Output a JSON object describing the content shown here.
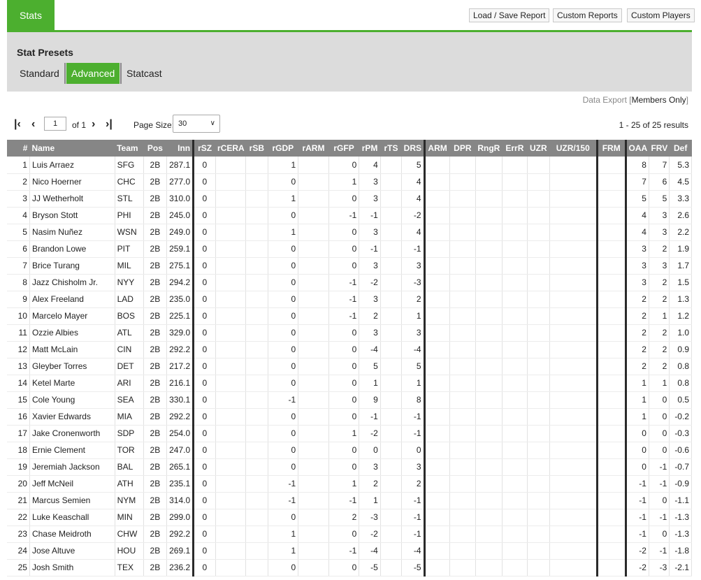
{
  "tabs": {
    "stats": "Stats"
  },
  "top_buttons": {
    "load_save": "Load / Save Report",
    "custom_reports": "Custom Reports",
    "custom_players": "Custom Players"
  },
  "presets": {
    "title": "Stat Presets",
    "items": [
      "Standard",
      "Advanced",
      "Statcast"
    ],
    "active": "Advanced"
  },
  "data_export": {
    "label": "Data Export",
    "bracket_open": "[",
    "members": "Members Only",
    "bracket_close": "]"
  },
  "pager": {
    "page": "1",
    "of": "of 1",
    "page_size_label": "Page Size:",
    "page_size": "30",
    "results": "1 - 25 of 25 results"
  },
  "colors": {
    "accent": "#4caf2f",
    "header_bg": "#868686",
    "presets_bg": "#dcdcdc"
  },
  "icons": [
    "first-page-icon",
    "prev-page-icon",
    "next-page-icon",
    "last-page-icon",
    "chevron-down-icon"
  ],
  "table": {
    "headers": [
      "#",
      "Name",
      "Team",
      "Pos",
      "Inn",
      "rSZ",
      "rCERA",
      "rSB",
      "rGDP",
      "rARM",
      "rGFP",
      "rPM",
      "rTS",
      "DRS",
      "ARM",
      "DPR",
      "RngR",
      "ErrR",
      "UZR",
      "UZR/150",
      "FRM",
      "OAA",
      "FRV",
      "Def"
    ],
    "rows": [
      [
        "1",
        "Luis Arraez",
        "SFG",
        "2B",
        "287.1",
        "0",
        "",
        "",
        "1",
        "",
        "0",
        "4",
        "",
        "5",
        "",
        "",
        "",
        "",
        "",
        "",
        "",
        "8",
        "7",
        "5.3"
      ],
      [
        "2",
        "Nico Hoerner",
        "CHC",
        "2B",
        "277.0",
        "0",
        "",
        "",
        "0",
        "",
        "1",
        "3",
        "",
        "4",
        "",
        "",
        "",
        "",
        "",
        "",
        "",
        "7",
        "6",
        "4.5"
      ],
      [
        "3",
        "JJ Wetherholt",
        "STL",
        "2B",
        "310.0",
        "0",
        "",
        "",
        "1",
        "",
        "0",
        "3",
        "",
        "4",
        "",
        "",
        "",
        "",
        "",
        "",
        "",
        "5",
        "5",
        "3.3"
      ],
      [
        "4",
        "Bryson Stott",
        "PHI",
        "2B",
        "245.0",
        "0",
        "",
        "",
        "0",
        "",
        "-1",
        "-1",
        "",
        "-2",
        "",
        "",
        "",
        "",
        "",
        "",
        "",
        "4",
        "3",
        "2.6"
      ],
      [
        "5",
        "Nasim Nuñez",
        "WSN",
        "2B",
        "249.0",
        "0",
        "",
        "",
        "1",
        "",
        "0",
        "3",
        "",
        "4",
        "",
        "",
        "",
        "",
        "",
        "",
        "",
        "4",
        "3",
        "2.2"
      ],
      [
        "6",
        "Brandon Lowe",
        "PIT",
        "2B",
        "259.1",
        "0",
        "",
        "",
        "0",
        "",
        "0",
        "-1",
        "",
        "-1",
        "",
        "",
        "",
        "",
        "",
        "",
        "",
        "3",
        "2",
        "1.9"
      ],
      [
        "7",
        "Brice Turang",
        "MIL",
        "2B",
        "275.1",
        "0",
        "",
        "",
        "0",
        "",
        "0",
        "3",
        "",
        "3",
        "",
        "",
        "",
        "",
        "",
        "",
        "",
        "3",
        "3",
        "1.7"
      ],
      [
        "8",
        "Jazz Chisholm Jr.",
        "NYY",
        "2B",
        "294.2",
        "0",
        "",
        "",
        "0",
        "",
        "-1",
        "-2",
        "",
        "-3",
        "",
        "",
        "",
        "",
        "",
        "",
        "",
        "3",
        "2",
        "1.5"
      ],
      [
        "9",
        "Alex Freeland",
        "LAD",
        "2B",
        "235.0",
        "0",
        "",
        "",
        "0",
        "",
        "-1",
        "3",
        "",
        "2",
        "",
        "",
        "",
        "",
        "",
        "",
        "",
        "2",
        "2",
        "1.3"
      ],
      [
        "10",
        "Marcelo Mayer",
        "BOS",
        "2B",
        "225.1",
        "0",
        "",
        "",
        "0",
        "",
        "-1",
        "2",
        "",
        "1",
        "",
        "",
        "",
        "",
        "",
        "",
        "",
        "2",
        "1",
        "1.2"
      ],
      [
        "11",
        "Ozzie Albies",
        "ATL",
        "2B",
        "329.0",
        "0",
        "",
        "",
        "0",
        "",
        "0",
        "3",
        "",
        "3",
        "",
        "",
        "",
        "",
        "",
        "",
        "",
        "2",
        "2",
        "1.0"
      ],
      [
        "12",
        "Matt McLain",
        "CIN",
        "2B",
        "292.2",
        "0",
        "",
        "",
        "0",
        "",
        "0",
        "-4",
        "",
        "-4",
        "",
        "",
        "",
        "",
        "",
        "",
        "",
        "2",
        "2",
        "0.9"
      ],
      [
        "13",
        "Gleyber Torres",
        "DET",
        "2B",
        "217.2",
        "0",
        "",
        "",
        "0",
        "",
        "0",
        "5",
        "",
        "5",
        "",
        "",
        "",
        "",
        "",
        "",
        "",
        "2",
        "2",
        "0.8"
      ],
      [
        "14",
        "Ketel Marte",
        "ARI",
        "2B",
        "216.1",
        "0",
        "",
        "",
        "0",
        "",
        "0",
        "1",
        "",
        "1",
        "",
        "",
        "",
        "",
        "",
        "",
        "",
        "1",
        "1",
        "0.8"
      ],
      [
        "15",
        "Cole Young",
        "SEA",
        "2B",
        "330.1",
        "0",
        "",
        "",
        "-1",
        "",
        "0",
        "9",
        "",
        "8",
        "",
        "",
        "",
        "",
        "",
        "",
        "",
        "1",
        "0",
        "0.5"
      ],
      [
        "16",
        "Xavier Edwards",
        "MIA",
        "2B",
        "292.2",
        "0",
        "",
        "",
        "0",
        "",
        "0",
        "-1",
        "",
        "-1",
        "",
        "",
        "",
        "",
        "",
        "",
        "",
        "1",
        "0",
        "-0.2"
      ],
      [
        "17",
        "Jake Cronenworth",
        "SDP",
        "2B",
        "254.0",
        "0",
        "",
        "",
        "0",
        "",
        "1",
        "-2",
        "",
        "-1",
        "",
        "",
        "",
        "",
        "",
        "",
        "",
        "0",
        "0",
        "-0.3"
      ],
      [
        "18",
        "Ernie Clement",
        "TOR",
        "2B",
        "247.0",
        "0",
        "",
        "",
        "0",
        "",
        "0",
        "0",
        "",
        "0",
        "",
        "",
        "",
        "",
        "",
        "",
        "",
        "0",
        "0",
        "-0.6"
      ],
      [
        "19",
        "Jeremiah Jackson",
        "BAL",
        "2B",
        "265.1",
        "0",
        "",
        "",
        "0",
        "",
        "0",
        "3",
        "",
        "3",
        "",
        "",
        "",
        "",
        "",
        "",
        "",
        "0",
        "-1",
        "-0.7"
      ],
      [
        "20",
        "Jeff McNeil",
        "ATH",
        "2B",
        "235.1",
        "0",
        "",
        "",
        "-1",
        "",
        "1",
        "2",
        "",
        "2",
        "",
        "",
        "",
        "",
        "",
        "",
        "",
        "-1",
        "-1",
        "-0.9"
      ],
      [
        "21",
        "Marcus Semien",
        "NYM",
        "2B",
        "314.0",
        "0",
        "",
        "",
        "-1",
        "",
        "-1",
        "1",
        "",
        "-1",
        "",
        "",
        "",
        "",
        "",
        "",
        "",
        "-1",
        "0",
        "-1.1"
      ],
      [
        "22",
        "Luke Keaschall",
        "MIN",
        "2B",
        "299.0",
        "0",
        "",
        "",
        "0",
        "",
        "2",
        "-3",
        "",
        "-1",
        "",
        "",
        "",
        "",
        "",
        "",
        "",
        "-1",
        "-1",
        "-1.3"
      ],
      [
        "23",
        "Chase Meidroth",
        "CHW",
        "2B",
        "292.2",
        "0",
        "",
        "",
        "1",
        "",
        "0",
        "-2",
        "",
        "-1",
        "",
        "",
        "",
        "",
        "",
        "",
        "",
        "-1",
        "0",
        "-1.3"
      ],
      [
        "24",
        "Jose Altuve",
        "HOU",
        "2B",
        "269.1",
        "0",
        "",
        "",
        "1",
        "",
        "-1",
        "-4",
        "",
        "-4",
        "",
        "",
        "",
        "",
        "",
        "",
        "",
        "-2",
        "-1",
        "-1.8"
      ],
      [
        "25",
        "Josh Smith",
        "TEX",
        "2B",
        "236.2",
        "0",
        "",
        "",
        "0",
        "",
        "0",
        "-5",
        "",
        "-5",
        "",
        "",
        "",
        "",
        "",
        "",
        "",
        "-2",
        "-3",
        "-2.1"
      ]
    ]
  }
}
